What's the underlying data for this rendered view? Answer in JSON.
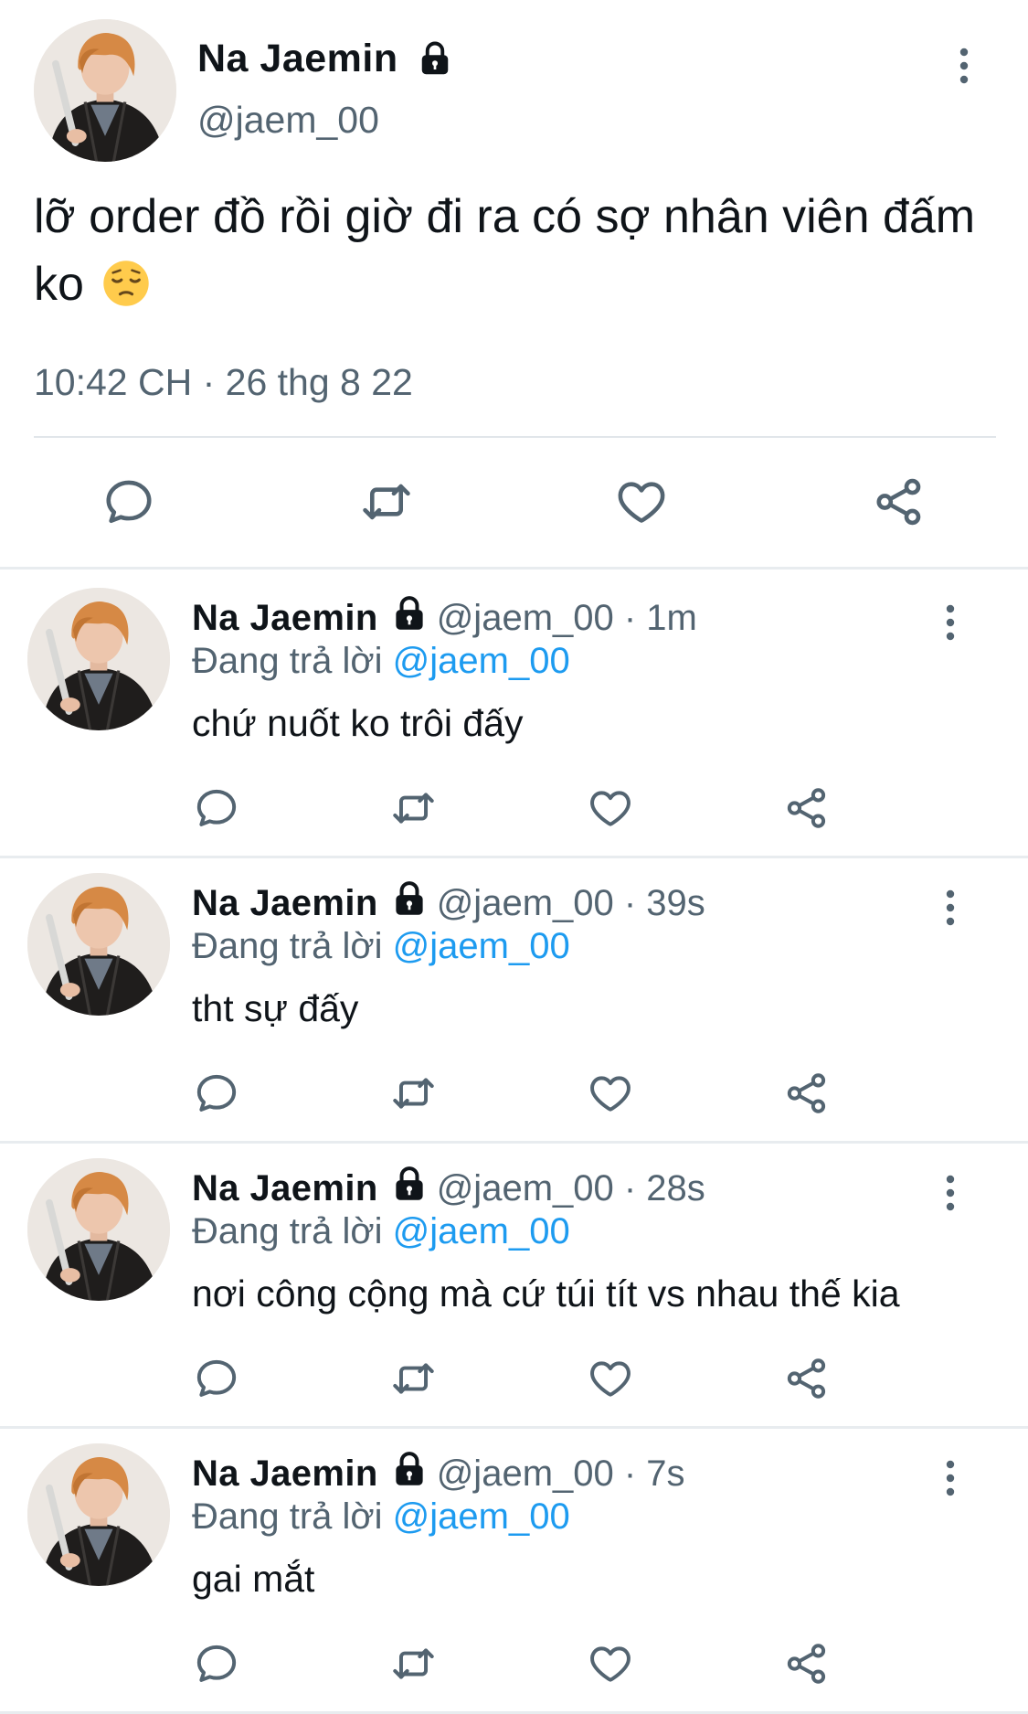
{
  "main_tweet": {
    "display_name": "Na Jaemin",
    "handle": "@jaem_00",
    "text": "lỡ order đồ rồi giờ đi ra có sợ nhân viên đấm ko",
    "emoji": "pensive-face",
    "timestamp": "10:42 CH · 26 thg 8 22",
    "protected": true,
    "actions": [
      "reply-icon",
      "retweet-icon",
      "like-icon",
      "share-icon"
    ]
  },
  "replies": [
    {
      "display_name": "Na Jaemin",
      "meta": "@jaem_00 · 1m",
      "replying_prefix": "Đang trả lời",
      "replying_to": "@jaem_00",
      "text": "chứ nuốt ko trôi đấy"
    },
    {
      "display_name": "Na Jaemin",
      "meta": "@jaem_00 · 39s",
      "replying_prefix": "Đang trả lời",
      "replying_to": "@jaem_00",
      "text": "tht sự đấy"
    },
    {
      "display_name": "Na Jaemin",
      "meta": "@jaem_00 · 28s",
      "replying_prefix": "Đang trả lời",
      "replying_to": "@jaem_00",
      "text": "nơi công cộng mà cứ túi tít vs nhau thế kia"
    },
    {
      "display_name": "Na Jaemin",
      "meta": "@jaem_00 · 7s",
      "replying_prefix": "Đang trả lời",
      "replying_to": "@jaem_00",
      "text": "gai mắt"
    }
  ],
  "colors": {
    "text": "#0f1419",
    "secondary": "#536471",
    "mention": "#1d9bf0",
    "divider": "#e8ecef"
  }
}
